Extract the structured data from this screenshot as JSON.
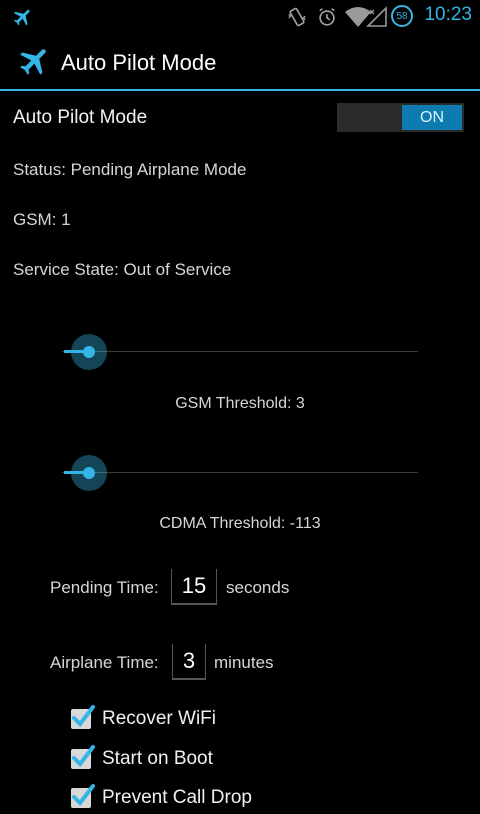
{
  "status_bar": {
    "time": "10:23",
    "battery_level": "58",
    "left_icon": "airplane-icon",
    "icons": [
      "vibrate-icon",
      "alarm-icon",
      "wifi-icon",
      "signal-icon"
    ]
  },
  "action_bar": {
    "app_icon": "airplane-icon",
    "title": "Auto Pilot Mode"
  },
  "main_toggle": {
    "label": "Auto Pilot Mode",
    "state": "ON"
  },
  "status_lines": {
    "status": "Status: Pending Airplane Mode",
    "gsm": "GSM: 1",
    "service_state": "Service State: Out of Service"
  },
  "gsm_slider": {
    "caption": "GSM Threshold: 3",
    "value": 3,
    "fraction": 0.01
  },
  "cdma_slider": {
    "caption": "CDMA Threshold: -113",
    "value": -113,
    "fraction": 0.01
  },
  "pending_time": {
    "label": "Pending Time:",
    "value": "15",
    "unit": "seconds"
  },
  "airplane_time": {
    "label": "Airplane Time:",
    "value": "3",
    "unit": "minutes"
  },
  "checkboxes": [
    {
      "label": "Recover WiFi",
      "checked": true
    },
    {
      "label": "Start on Boot",
      "checked": true
    },
    {
      "label": "Prevent Call Drop",
      "checked": true
    }
  ],
  "colors": {
    "accent": "#33b5e5",
    "background": "#000000"
  }
}
